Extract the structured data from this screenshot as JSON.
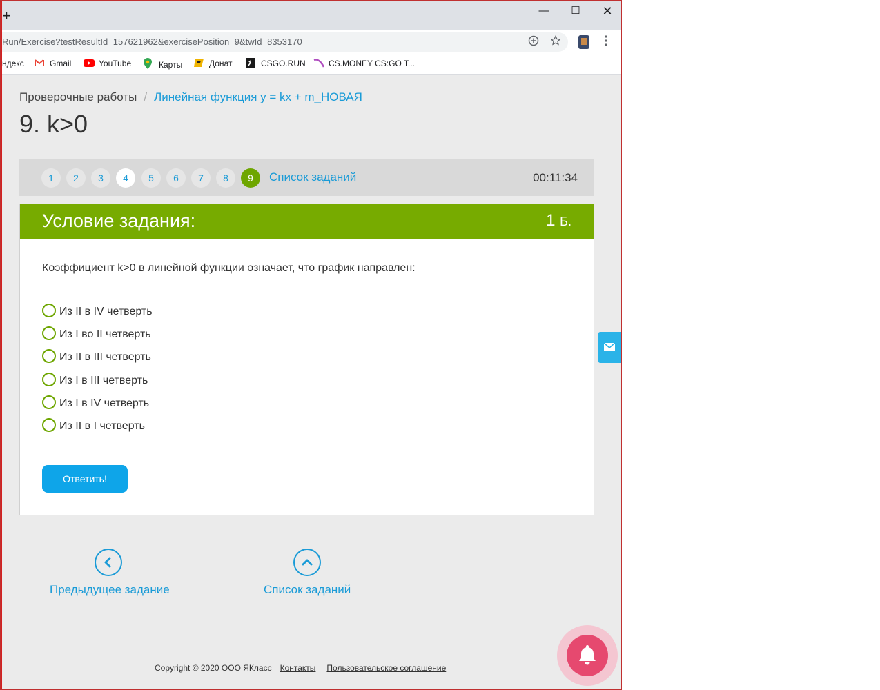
{
  "browser": {
    "new_tab_symbol": "+",
    "window_controls": {
      "minimize": "—",
      "maximize": "☐",
      "close": "✕"
    },
    "url": "Run/Exercise?testResultId=157621962&exercisePosition=9&twId=8353170",
    "bookmarks": [
      {
        "label": "ндекс",
        "icon": "yandex-icon"
      },
      {
        "label": "Gmail",
        "icon": "gmail-icon"
      },
      {
        "label": "YouTube",
        "icon": "youtube-icon"
      },
      {
        "label": "Карты",
        "icon": "maps-pin-icon"
      },
      {
        "label": "Донат",
        "icon": "donat-icon"
      },
      {
        "label": "CSGO.RUN",
        "icon": "csgorun-icon"
      },
      {
        "label": "CS.MONEY CS:GO T...",
        "icon": "csmoney-icon"
      }
    ]
  },
  "breadcrumb": {
    "root": "Проверочные работы",
    "separator": "/",
    "current": "Линейная функция y = kx + m_НОВАЯ"
  },
  "exercise_title": "9. k>0",
  "pager": {
    "numbers": [
      "1",
      "2",
      "3",
      "4",
      "5",
      "6",
      "7",
      "8",
      "9"
    ],
    "visited": "4",
    "current": "9",
    "list_label": "Список заданий",
    "timer": "00:11:34"
  },
  "task": {
    "header": "Условие задания:",
    "points_value": "1",
    "points_unit": "Б.",
    "question": "Коэффициент k>0 в линейной функции означает, что график направлен:",
    "options": [
      "Из II в IV четверть",
      "Из I во II четверть",
      "Из II в III четверть",
      "Из I в III четверть",
      "Из I в IV четверть",
      "Из II в I четверть"
    ],
    "answer_button": "Ответить!"
  },
  "nav": {
    "prev_label": "Предыдущее задание",
    "list_label": "Список заданий"
  },
  "footer": {
    "copyright": "Copyright © 2020 ООО ЯКласс",
    "contacts": "Контакты",
    "agreement": "Пользовательское соглашение"
  },
  "colors": {
    "accent_green": "#77ab00",
    "link_blue": "#1a9bd7",
    "button_blue": "#0ea5e9",
    "bell_pink": "#e6496f"
  }
}
